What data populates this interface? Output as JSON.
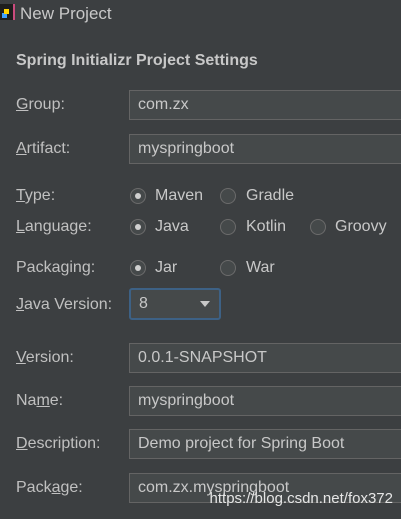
{
  "window": {
    "title": "New Project"
  },
  "header": "Spring Initializr Project Settings",
  "fields": {
    "group": {
      "label_ul": "G",
      "label_rest": "roup:",
      "value": "com.zx"
    },
    "artifact": {
      "label_ul": "A",
      "label_rest": "rtifact:",
      "value": "myspringboot"
    },
    "version": {
      "label_ul": "V",
      "label_rest": "ersion:",
      "value": "0.0.1-SNAPSHOT"
    },
    "name": {
      "label_pre": "Na",
      "label_ul": "m",
      "label_rest": "e:",
      "value": "myspringboot"
    },
    "description": {
      "label_ul": "D",
      "label_rest": "escription:",
      "value": "Demo project for Spring Boot"
    },
    "package": {
      "label_pre": "Pack",
      "label_ul": "a",
      "label_rest": "ge:",
      "value": "com.zx.myspringboot"
    }
  },
  "type": {
    "label_ul": "T",
    "label_rest": "ype:",
    "options": [
      "Maven",
      "Gradle"
    ],
    "selected": "Maven"
  },
  "language": {
    "label_ul": "L",
    "label_rest": "anguage:",
    "options": [
      "Java",
      "Kotlin",
      "Groovy"
    ],
    "selected": "Java"
  },
  "packaging": {
    "label": "Packaging:",
    "options": [
      "Jar",
      "War"
    ],
    "selected": "Jar"
  },
  "java_version": {
    "label_ul": "J",
    "label_rest": "ava Version:",
    "value": "8"
  },
  "watermark": "https://blog.csdn.net/fox372"
}
